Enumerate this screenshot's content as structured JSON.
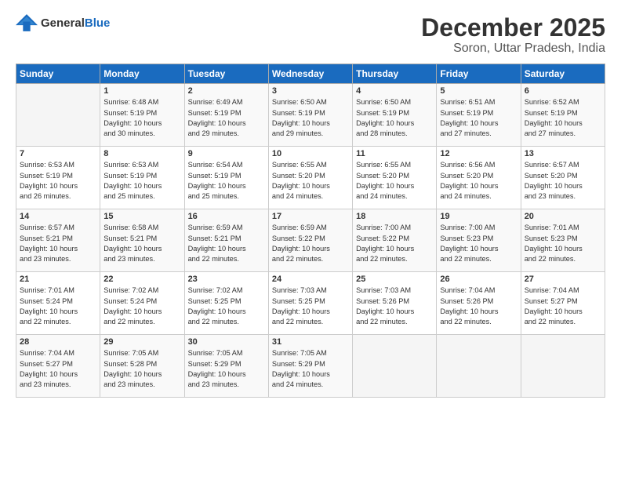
{
  "logo": {
    "general": "General",
    "blue": "Blue"
  },
  "title": "December 2025",
  "location": "Soron, Uttar Pradesh, India",
  "headers": [
    "Sunday",
    "Monday",
    "Tuesday",
    "Wednesday",
    "Thursday",
    "Friday",
    "Saturday"
  ],
  "weeks": [
    [
      {
        "day": "",
        "info": ""
      },
      {
        "day": "1",
        "info": "Sunrise: 6:48 AM\nSunset: 5:19 PM\nDaylight: 10 hours\nand 30 minutes."
      },
      {
        "day": "2",
        "info": "Sunrise: 6:49 AM\nSunset: 5:19 PM\nDaylight: 10 hours\nand 29 minutes."
      },
      {
        "day": "3",
        "info": "Sunrise: 6:50 AM\nSunset: 5:19 PM\nDaylight: 10 hours\nand 29 minutes."
      },
      {
        "day": "4",
        "info": "Sunrise: 6:50 AM\nSunset: 5:19 PM\nDaylight: 10 hours\nand 28 minutes."
      },
      {
        "day": "5",
        "info": "Sunrise: 6:51 AM\nSunset: 5:19 PM\nDaylight: 10 hours\nand 27 minutes."
      },
      {
        "day": "6",
        "info": "Sunrise: 6:52 AM\nSunset: 5:19 PM\nDaylight: 10 hours\nand 27 minutes."
      }
    ],
    [
      {
        "day": "7",
        "info": "Sunrise: 6:53 AM\nSunset: 5:19 PM\nDaylight: 10 hours\nand 26 minutes."
      },
      {
        "day": "8",
        "info": "Sunrise: 6:53 AM\nSunset: 5:19 PM\nDaylight: 10 hours\nand 25 minutes."
      },
      {
        "day": "9",
        "info": "Sunrise: 6:54 AM\nSunset: 5:19 PM\nDaylight: 10 hours\nand 25 minutes."
      },
      {
        "day": "10",
        "info": "Sunrise: 6:55 AM\nSunset: 5:20 PM\nDaylight: 10 hours\nand 24 minutes."
      },
      {
        "day": "11",
        "info": "Sunrise: 6:55 AM\nSunset: 5:20 PM\nDaylight: 10 hours\nand 24 minutes."
      },
      {
        "day": "12",
        "info": "Sunrise: 6:56 AM\nSunset: 5:20 PM\nDaylight: 10 hours\nand 24 minutes."
      },
      {
        "day": "13",
        "info": "Sunrise: 6:57 AM\nSunset: 5:20 PM\nDaylight: 10 hours\nand 23 minutes."
      }
    ],
    [
      {
        "day": "14",
        "info": "Sunrise: 6:57 AM\nSunset: 5:21 PM\nDaylight: 10 hours\nand 23 minutes."
      },
      {
        "day": "15",
        "info": "Sunrise: 6:58 AM\nSunset: 5:21 PM\nDaylight: 10 hours\nand 23 minutes."
      },
      {
        "day": "16",
        "info": "Sunrise: 6:59 AM\nSunset: 5:21 PM\nDaylight: 10 hours\nand 22 minutes."
      },
      {
        "day": "17",
        "info": "Sunrise: 6:59 AM\nSunset: 5:22 PM\nDaylight: 10 hours\nand 22 minutes."
      },
      {
        "day": "18",
        "info": "Sunrise: 7:00 AM\nSunset: 5:22 PM\nDaylight: 10 hours\nand 22 minutes."
      },
      {
        "day": "19",
        "info": "Sunrise: 7:00 AM\nSunset: 5:23 PM\nDaylight: 10 hours\nand 22 minutes."
      },
      {
        "day": "20",
        "info": "Sunrise: 7:01 AM\nSunset: 5:23 PM\nDaylight: 10 hours\nand 22 minutes."
      }
    ],
    [
      {
        "day": "21",
        "info": "Sunrise: 7:01 AM\nSunset: 5:24 PM\nDaylight: 10 hours\nand 22 minutes."
      },
      {
        "day": "22",
        "info": "Sunrise: 7:02 AM\nSunset: 5:24 PM\nDaylight: 10 hours\nand 22 minutes."
      },
      {
        "day": "23",
        "info": "Sunrise: 7:02 AM\nSunset: 5:25 PM\nDaylight: 10 hours\nand 22 minutes."
      },
      {
        "day": "24",
        "info": "Sunrise: 7:03 AM\nSunset: 5:25 PM\nDaylight: 10 hours\nand 22 minutes."
      },
      {
        "day": "25",
        "info": "Sunrise: 7:03 AM\nSunset: 5:26 PM\nDaylight: 10 hours\nand 22 minutes."
      },
      {
        "day": "26",
        "info": "Sunrise: 7:04 AM\nSunset: 5:26 PM\nDaylight: 10 hours\nand 22 minutes."
      },
      {
        "day": "27",
        "info": "Sunrise: 7:04 AM\nSunset: 5:27 PM\nDaylight: 10 hours\nand 22 minutes."
      }
    ],
    [
      {
        "day": "28",
        "info": "Sunrise: 7:04 AM\nSunset: 5:27 PM\nDaylight: 10 hours\nand 23 minutes."
      },
      {
        "day": "29",
        "info": "Sunrise: 7:05 AM\nSunset: 5:28 PM\nDaylight: 10 hours\nand 23 minutes."
      },
      {
        "day": "30",
        "info": "Sunrise: 7:05 AM\nSunset: 5:29 PM\nDaylight: 10 hours\nand 23 minutes."
      },
      {
        "day": "31",
        "info": "Sunrise: 7:05 AM\nSunset: 5:29 PM\nDaylight: 10 hours\nand 24 minutes."
      },
      {
        "day": "",
        "info": ""
      },
      {
        "day": "",
        "info": ""
      },
      {
        "day": "",
        "info": ""
      }
    ]
  ]
}
